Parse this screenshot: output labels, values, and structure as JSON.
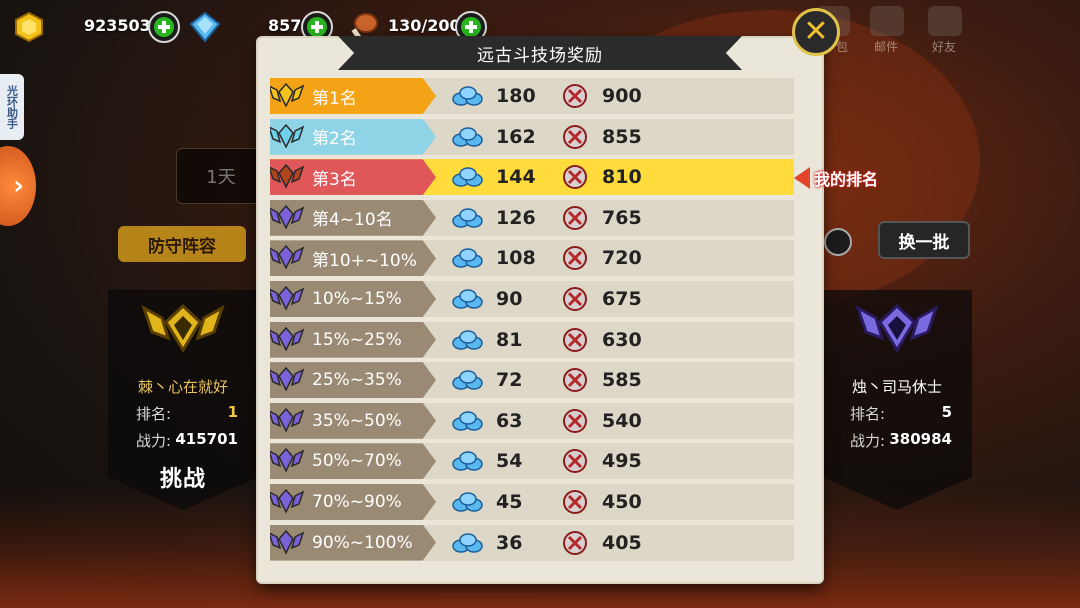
{
  "resources": {
    "gold": {
      "value": "923503",
      "icon": "gold-ingot-icon"
    },
    "gems": {
      "value": "857",
      "icon": "blue-gem-icon"
    },
    "stamina": {
      "value": "130/200",
      "icon": "drumstick-icon"
    }
  },
  "top_menu": [
    {
      "label": "包",
      "icon": "bag-icon"
    },
    {
      "label": "邮件",
      "icon": "mail-icon"
    },
    {
      "label": "好友",
      "icon": "friends-icon"
    }
  ],
  "helper_tab": "光环助手",
  "background": {
    "time_text": "1天",
    "defense_button": "防守阵容",
    "swap_button": "换一批",
    "players": [
      {
        "name": "棘丶心在就好",
        "rank_label": "排名:",
        "rank": "1",
        "power_label": "战力:",
        "power": "415701",
        "action": "挑战",
        "emblem_color": "#e2b41c"
      },
      {
        "name": "烛丶司马休士",
        "rank_label": "排名:",
        "rank": "5",
        "power_label": "战力:",
        "power": "380984",
        "emblem_color": "#6a5ad0"
      }
    ]
  },
  "modal": {
    "title": "远古斗技场奖励",
    "my_rank_tag": "我的排名",
    "colors": {
      "gold": "#f5a316",
      "silver": "#8fd4e6",
      "bronze": "#e0575a",
      "default": "#9a8a73",
      "my_row": "#ffdc3c"
    },
    "rows": [
      {
        "rank": "第1名",
        "gems": "180",
        "coins": "900",
        "tier": "gold"
      },
      {
        "rank": "第2名",
        "gems": "162",
        "coins": "855",
        "tier": "silver"
      },
      {
        "rank": "第3名",
        "gems": "144",
        "coins": "810",
        "tier": "bronze",
        "mine": true
      },
      {
        "rank": "第4~10名",
        "gems": "126",
        "coins": "765",
        "tier": "default"
      },
      {
        "rank": "第10+~10%",
        "gems": "108",
        "coins": "720",
        "tier": "default"
      },
      {
        "rank": "10%~15%",
        "gems": "90",
        "coins": "675",
        "tier": "default"
      },
      {
        "rank": "15%~25%",
        "gems": "81",
        "coins": "630",
        "tier": "default"
      },
      {
        "rank": "25%~35%",
        "gems": "72",
        "coins": "585",
        "tier": "default"
      },
      {
        "rank": "35%~50%",
        "gems": "63",
        "coins": "540",
        "tier": "default"
      },
      {
        "rank": "50%~70%",
        "gems": "54",
        "coins": "495",
        "tier": "default"
      },
      {
        "rank": "70%~90%",
        "gems": "45",
        "coins": "450",
        "tier": "default"
      },
      {
        "rank": "90%~100%",
        "gems": "36",
        "coins": "405",
        "tier": "default"
      }
    ]
  }
}
